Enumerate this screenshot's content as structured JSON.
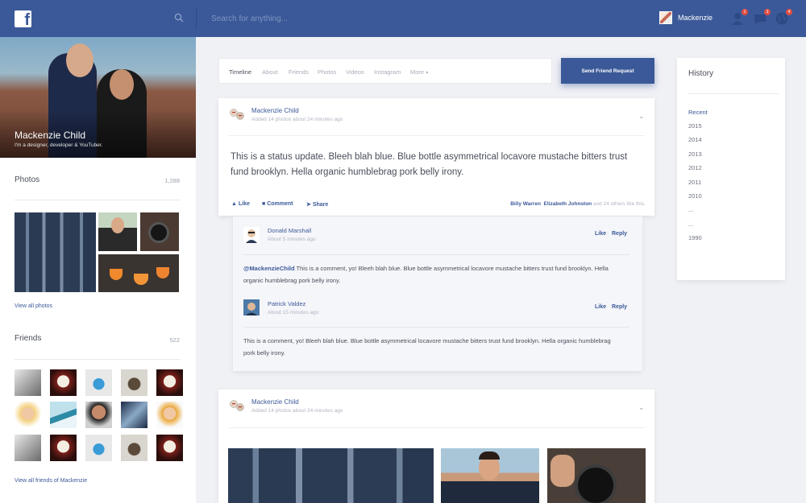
{
  "topbar": {
    "logo": "f",
    "search_placeholder": "Search for anything...",
    "user_name": "Mackenzie",
    "badges": [
      "1",
      "3",
      "4"
    ]
  },
  "profile": {
    "name": "Mackenzie Child",
    "bio": "I'm a designer, developer & YouTuber."
  },
  "photos": {
    "title": "Photos",
    "count": "1,288",
    "view_all": "View all photos"
  },
  "friends": {
    "title": "Friends",
    "count": "522",
    "view_all": "View all friends of Mackenzie"
  },
  "tabs": [
    "Timeline",
    "About",
    "Friends",
    "Photos",
    "Videos",
    "Instagram",
    "More"
  ],
  "send_request": "Send Friend Request",
  "post1": {
    "author": "Mackenzie Child",
    "meta": "Added 14 photos about 24 minutes ago",
    "text": "This is a status update. Bleeh blah blue. Blue bottle asymmetrical locavore mustache bitters trust fund brooklyn. Hella organic humblebrag pork belly irony.",
    "like": "Like",
    "comment": "Comment",
    "share": "Share",
    "liker1": "Billy Warren",
    "liker2": "Elizabeth Johnston",
    "likers_suffix": "and 24 others like this."
  },
  "comments": [
    {
      "name": "Donald Marshall",
      "time": "About 5 minutes ago",
      "like": "Like",
      "reply": "Reply",
      "mention": "@MackenzieChild",
      "text": " This is a comment, yo! Bleeh blah blue. Blue bottle asymmetrical locavore mustache bitters trust fund brooklyn. Hella organic humblebrag pork belly irony."
    },
    {
      "name": "Patrick Valdez",
      "time": "About 15 minutes ago",
      "like": "Like",
      "reply": "Reply",
      "text": "This is a comment, yo! Bleeh blah blue. Blue bottle asymmetrical locavore mustache bitters trust fund brooklyn. Hella organic humblebrag pork belly irony."
    }
  ],
  "post2": {
    "author": "Mackenzie Child",
    "meta": "Added 14 photos about 24 minutes ago"
  },
  "history": {
    "title": "History",
    "items": [
      "Recent",
      "2015",
      "2014",
      "2013",
      "2012",
      "2011",
      "2010",
      "...",
      "...",
      "1990"
    ]
  },
  "colors": {
    "brand": "#3b5998",
    "badge": "#e04e43"
  }
}
